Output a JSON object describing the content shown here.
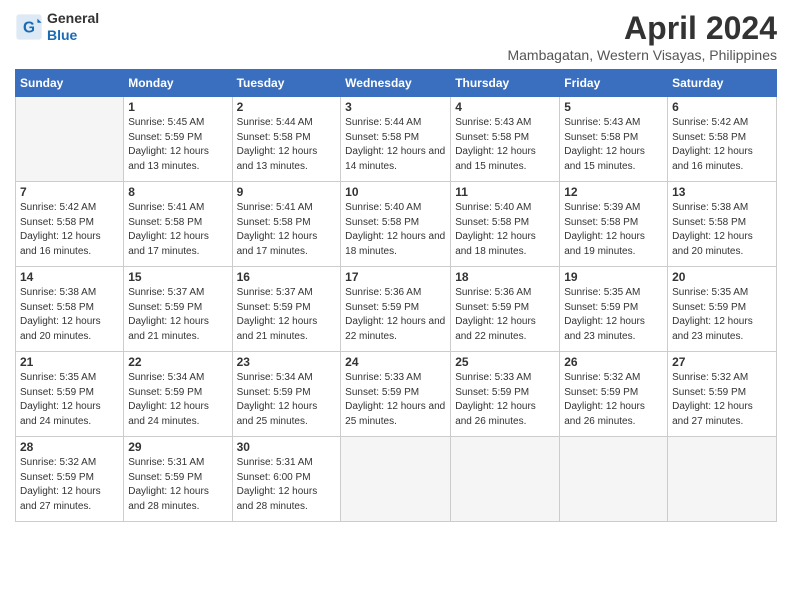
{
  "header": {
    "logo": {
      "general": "General",
      "blue": "Blue"
    },
    "title": "April 2024",
    "location": "Mambagatan, Western Visayas, Philippines"
  },
  "calendar": {
    "weekdays": [
      "Sunday",
      "Monday",
      "Tuesday",
      "Wednesday",
      "Thursday",
      "Friday",
      "Saturday"
    ],
    "weeks": [
      [
        {
          "day": "",
          "empty": true
        },
        {
          "day": "1",
          "sunrise": "5:45 AM",
          "sunset": "5:59 PM",
          "daylight": "12 hours and 13 minutes."
        },
        {
          "day": "2",
          "sunrise": "5:44 AM",
          "sunset": "5:58 PM",
          "daylight": "12 hours and 13 minutes."
        },
        {
          "day": "3",
          "sunrise": "5:44 AM",
          "sunset": "5:58 PM",
          "daylight": "12 hours and 14 minutes."
        },
        {
          "day": "4",
          "sunrise": "5:43 AM",
          "sunset": "5:58 PM",
          "daylight": "12 hours and 15 minutes."
        },
        {
          "day": "5",
          "sunrise": "5:43 AM",
          "sunset": "5:58 PM",
          "daylight": "12 hours and 15 minutes."
        },
        {
          "day": "6",
          "sunrise": "5:42 AM",
          "sunset": "5:58 PM",
          "daylight": "12 hours and 16 minutes."
        }
      ],
      [
        {
          "day": "7",
          "sunrise": "5:42 AM",
          "sunset": "5:58 PM",
          "daylight": "12 hours and 16 minutes."
        },
        {
          "day": "8",
          "sunrise": "5:41 AM",
          "sunset": "5:58 PM",
          "daylight": "12 hours and 17 minutes."
        },
        {
          "day": "9",
          "sunrise": "5:41 AM",
          "sunset": "5:58 PM",
          "daylight": "12 hours and 17 minutes."
        },
        {
          "day": "10",
          "sunrise": "5:40 AM",
          "sunset": "5:58 PM",
          "daylight": "12 hours and 18 minutes."
        },
        {
          "day": "11",
          "sunrise": "5:40 AM",
          "sunset": "5:58 PM",
          "daylight": "12 hours and 18 minutes."
        },
        {
          "day": "12",
          "sunrise": "5:39 AM",
          "sunset": "5:58 PM",
          "daylight": "12 hours and 19 minutes."
        },
        {
          "day": "13",
          "sunrise": "5:38 AM",
          "sunset": "5:58 PM",
          "daylight": "12 hours and 20 minutes."
        }
      ],
      [
        {
          "day": "14",
          "sunrise": "5:38 AM",
          "sunset": "5:58 PM",
          "daylight": "12 hours and 20 minutes."
        },
        {
          "day": "15",
          "sunrise": "5:37 AM",
          "sunset": "5:59 PM",
          "daylight": "12 hours and 21 minutes."
        },
        {
          "day": "16",
          "sunrise": "5:37 AM",
          "sunset": "5:59 PM",
          "daylight": "12 hours and 21 minutes."
        },
        {
          "day": "17",
          "sunrise": "5:36 AM",
          "sunset": "5:59 PM",
          "daylight": "12 hours and 22 minutes."
        },
        {
          "day": "18",
          "sunrise": "5:36 AM",
          "sunset": "5:59 PM",
          "daylight": "12 hours and 22 minutes."
        },
        {
          "day": "19",
          "sunrise": "5:35 AM",
          "sunset": "5:59 PM",
          "daylight": "12 hours and 23 minutes."
        },
        {
          "day": "20",
          "sunrise": "5:35 AM",
          "sunset": "5:59 PM",
          "daylight": "12 hours and 23 minutes."
        }
      ],
      [
        {
          "day": "21",
          "sunrise": "5:35 AM",
          "sunset": "5:59 PM",
          "daylight": "12 hours and 24 minutes."
        },
        {
          "day": "22",
          "sunrise": "5:34 AM",
          "sunset": "5:59 PM",
          "daylight": "12 hours and 24 minutes."
        },
        {
          "day": "23",
          "sunrise": "5:34 AM",
          "sunset": "5:59 PM",
          "daylight": "12 hours and 25 minutes."
        },
        {
          "day": "24",
          "sunrise": "5:33 AM",
          "sunset": "5:59 PM",
          "daylight": "12 hours and 25 minutes."
        },
        {
          "day": "25",
          "sunrise": "5:33 AM",
          "sunset": "5:59 PM",
          "daylight": "12 hours and 26 minutes."
        },
        {
          "day": "26",
          "sunrise": "5:32 AM",
          "sunset": "5:59 PM",
          "daylight": "12 hours and 26 minutes."
        },
        {
          "day": "27",
          "sunrise": "5:32 AM",
          "sunset": "5:59 PM",
          "daylight": "12 hours and 27 minutes."
        }
      ],
      [
        {
          "day": "28",
          "sunrise": "5:32 AM",
          "sunset": "5:59 PM",
          "daylight": "12 hours and 27 minutes."
        },
        {
          "day": "29",
          "sunrise": "5:31 AM",
          "sunset": "5:59 PM",
          "daylight": "12 hours and 28 minutes."
        },
        {
          "day": "30",
          "sunrise": "5:31 AM",
          "sunset": "6:00 PM",
          "daylight": "12 hours and 28 minutes."
        },
        {
          "day": "",
          "empty": true
        },
        {
          "day": "",
          "empty": true
        },
        {
          "day": "",
          "empty": true
        },
        {
          "day": "",
          "empty": true
        }
      ]
    ]
  }
}
